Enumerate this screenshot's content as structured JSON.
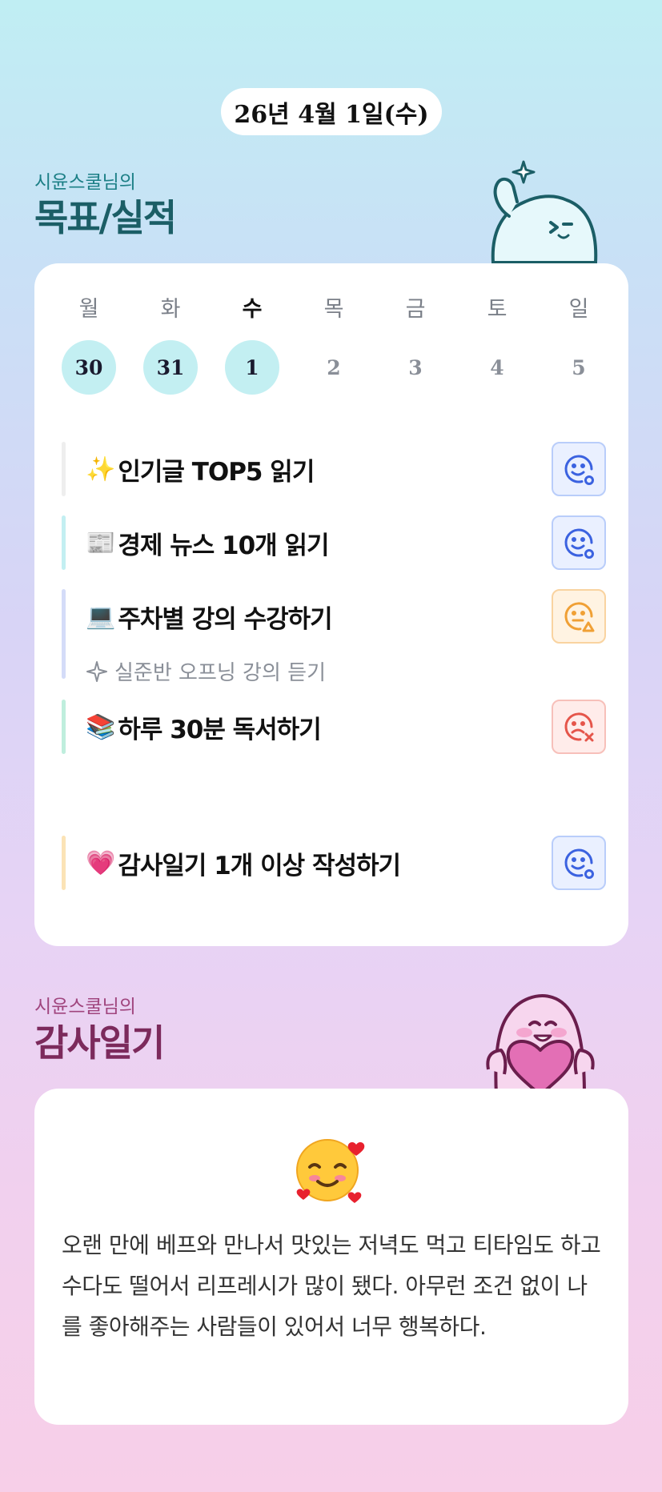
{
  "date_label": "26년 4월 1일(수)",
  "goals_section": {
    "subtitle": "시윤스쿨님의",
    "title": "목표/실적"
  },
  "week": [
    {
      "name": "월",
      "num": "30",
      "done": true,
      "today": false
    },
    {
      "name": "화",
      "num": "31",
      "done": true,
      "today": false
    },
    {
      "name": "수",
      "num": "1",
      "done": true,
      "today": true
    },
    {
      "name": "목",
      "num": "2",
      "done": false,
      "today": false
    },
    {
      "name": "금",
      "num": "3",
      "done": false,
      "today": false
    },
    {
      "name": "토",
      "num": "4",
      "done": false,
      "today": false
    },
    {
      "name": "일",
      "num": "5",
      "done": false,
      "today": false
    }
  ],
  "goals": [
    {
      "emoji": "✨",
      "label": "인기글 TOP5 읽기",
      "bar_color": "#eeeeee",
      "status": "good-icon"
    },
    {
      "emoji": "📰",
      "label": "경제 뉴스 10개 읽기",
      "bar_color": "#c3eff2",
      "status": "good-icon"
    },
    {
      "emoji": "💻",
      "label": " 주차별 강의 수강하기",
      "bar_color": "#d4dcf8",
      "status": "warning-icon",
      "sub_item": "실준반 오프닝 강의 듣기"
    },
    {
      "emoji": "📚",
      "label": " 하루 30분 독서하기",
      "bar_color": "#bfeedd",
      "status": "fail-icon"
    },
    {
      "emoji": "💗",
      "label": " 감사일기 1개 이상 작성하기",
      "bar_color": "#fbe3b6",
      "status": "good-icon"
    }
  ],
  "gratitude_section": {
    "subtitle": "시윤스쿨님의",
    "title": "감사일기"
  },
  "gratitude": {
    "emoji": "smiling-face-with-hearts-icon",
    "text": "오랜 만에 베프와 만나서 맛있는 저녁도 먹고 티타임도 하고 수다도 떨어서 리프레시가 많이 됐다. 아무런 조건 없이 나를 좋아해주는 사람들이 있어서 너무 행복하다."
  },
  "colors": {
    "good": "#3b62e0",
    "warning": "#f0a035",
    "fail": "#e5554a",
    "teal_title": "#1b5e66",
    "pink_title": "#7c2a5c"
  }
}
